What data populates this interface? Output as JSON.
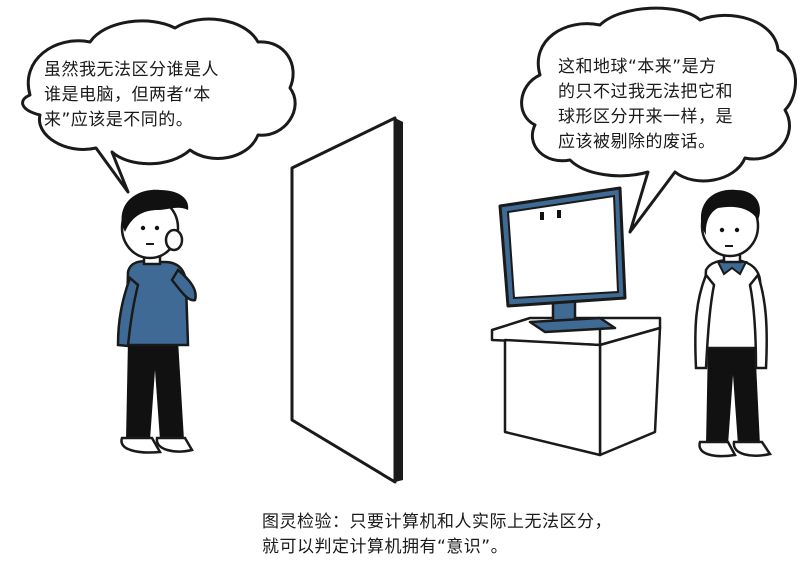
{
  "bubble_left": {
    "lines": [
      "虽然我无法区分谁是人",
      "谁是电脑，但两者“本",
      "来”应该是不同的。"
    ]
  },
  "bubble_right": {
    "lines": [
      "这和地球“本来”是方",
      "的只不过我无法把它和",
      "球形区分开来一样，是",
      "应该被剔除的废话。"
    ]
  },
  "caption": {
    "lines": [
      "图灵检验：只要计算机和人实际上无法区分，",
      "就可以判定计算机拥有“意识”。"
    ]
  },
  "colors": {
    "ink": "#1a1a1a",
    "sweater_left": "#3f6a96",
    "monitor_frame": "#3e6a93",
    "screen": "#ffffff",
    "pants": "#111111"
  }
}
